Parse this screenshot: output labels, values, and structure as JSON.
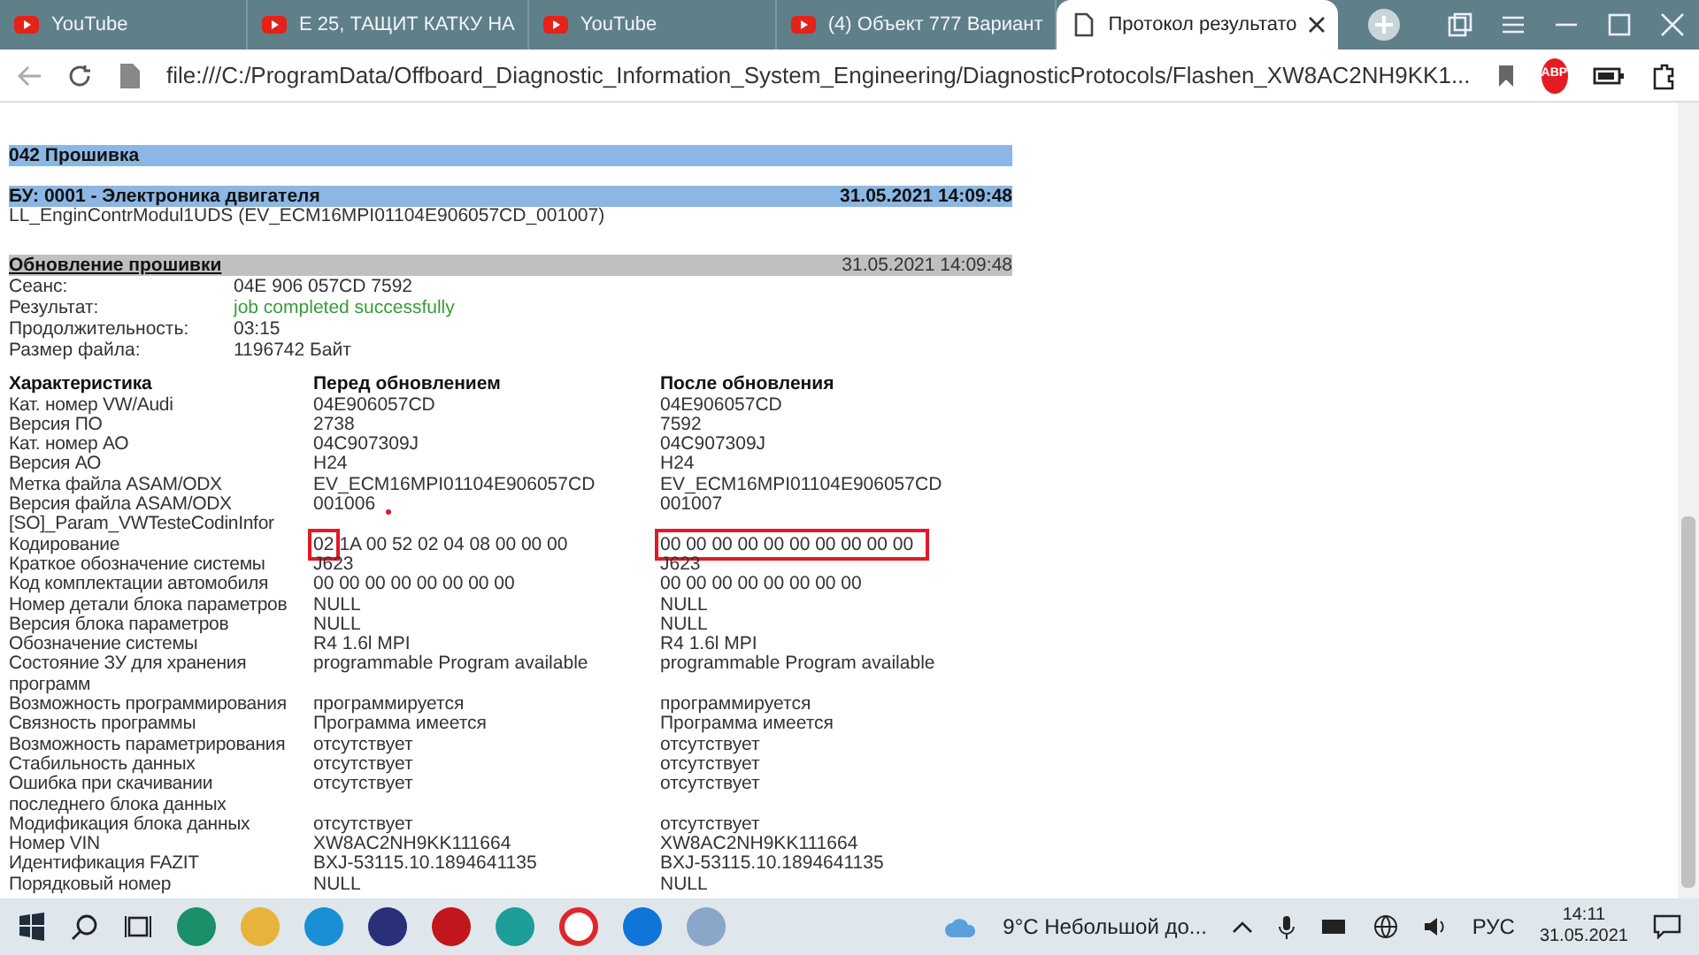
{
  "tabs": [
    {
      "title": "YouTube",
      "selected": false
    },
    {
      "title": "E 25, ТАЩИТ КАТКУ НА",
      "selected": false
    },
    {
      "title": "YouTube",
      "selected": false
    },
    {
      "title": "(4) Объект 777 Вариант",
      "selected": false
    },
    {
      "title": "Протокол результато",
      "selected": true
    }
  ],
  "address": "file:///C:/ProgramData/Offboard_Diagnostic_Information_System_Engineering/DiagnosticProtocols/Flashen_XW8AC2NH9KK1...",
  "toolbar_badge": "ABP",
  "report": {
    "section": "042 Прошивка",
    "unit": {
      "title": "БУ: 0001 - Электроника двигателя",
      "time": "31.05.2021 14:09:48",
      "subtitle": "LL_EnginContrModul1UDS (EV_ECM16MPI01104E906057CD_001007)"
    },
    "update": {
      "title": "Обновление прошивки",
      "time": "31.05.2021 14:09:48",
      "fields": [
        {
          "label": "Сеанс:",
          "value": "04E 906 057CD 7592",
          "kind": "plain"
        },
        {
          "label": "Результат:",
          "value": "job completed successfully",
          "kind": "success"
        },
        {
          "label": "Продолжительность:",
          "value": "03:15",
          "kind": "plain"
        },
        {
          "label": "Размер файла:",
          "value": "1196742 Байт",
          "kind": "plain"
        }
      ]
    },
    "columns": [
      "Характеристика",
      "Перед обновлением",
      "После обновления"
    ],
    "rows": [
      {
        "label": "Кат. номер VW/Audi",
        "before": "04E906057CD",
        "after": "04E906057CD"
      },
      {
        "label": "Версия ПО",
        "before": "2738",
        "after": "7592"
      },
      {
        "label": "Кат. номер АО",
        "before": "04C907309J",
        "after": "04C907309J"
      },
      {
        "label": "Версия АО",
        "before": "H24",
        "after": "H24"
      },
      {
        "label": "Метка файла ASAM/ODX",
        "before": "EV_ECM16MPI01104E906057CD",
        "after": "EV_ECM16MPI01104E906057CD"
      },
      {
        "label": "Версия файла ASAM/ODX",
        "before": "001006",
        "after": "001007"
      },
      {
        "label": "[SO]_Param_VWTesteCodinInfor",
        "before": "",
        "after": ""
      },
      {
        "label": "Кодирование",
        "before": [
          {
            "text": "02",
            "boxed": true
          },
          {
            "text": "1A 00 52 02 04 08 00 00 00",
            "boxed": false
          }
        ],
        "after": [
          {
            "text": "00 00 00 00 00 00 00 00 00 00",
            "boxed": true
          }
        ]
      },
      {
        "label": "Краткое обозначение системы",
        "before": "J623",
        "after": "J623"
      },
      {
        "label": "Код комплектации автомобиля",
        "before": "00 00 00 00 00 00 00 00",
        "after": "00 00 00 00 00 00 00 00"
      },
      {
        "label": "Номер детали блока параметров",
        "before": "NULL",
        "after": "NULL"
      },
      {
        "label": "Версия блока параметров",
        "before": "NULL",
        "after": "NULL"
      },
      {
        "label": "Обозначение системы",
        "before": "R4 1.6l MPI",
        "after": "R4 1.6l MPI"
      },
      {
        "label": "Состояние ЗУ для хранения программ",
        "before": "programmable Program available",
        "after": "programmable Program available"
      },
      {
        "label": "Возможность программирования",
        "before": "программируется",
        "after": "программируется"
      },
      {
        "label": "Связность программы",
        "before": "Программа имеется",
        "after": "Программа имеется"
      },
      {
        "label": "Возможность параметрирования",
        "before": "отсутствует",
        "after": "отсутствует"
      },
      {
        "label": "Стабильность данных",
        "before": "отсутствует",
        "after": "отсутствует"
      },
      {
        "label": "Ошибка при скачивании последнего блока данных",
        "before": "отсутствует",
        "after": "отсутствует"
      },
      {
        "label": "Модификация блока данных",
        "before": "отсутствует",
        "after": "отсутствует"
      },
      {
        "label": "Номер VIN",
        "before": "XW8AC2NH9KK111664",
        "after": "XW8AC2NH9KK111664"
      },
      {
        "label": "Идентификация FAZIT",
        "before": "BXJ-53115.10.1894641135",
        "after": "BXJ-53115.10.1894641135"
      },
      {
        "label": "Порядковый номер",
        "before": "NULL",
        "after": "NULL"
      }
    ]
  },
  "taskbar": {
    "weather": "9°C  Небольшой до...",
    "language": "РУС",
    "time": "14:11",
    "date": "31.05.2021"
  }
}
